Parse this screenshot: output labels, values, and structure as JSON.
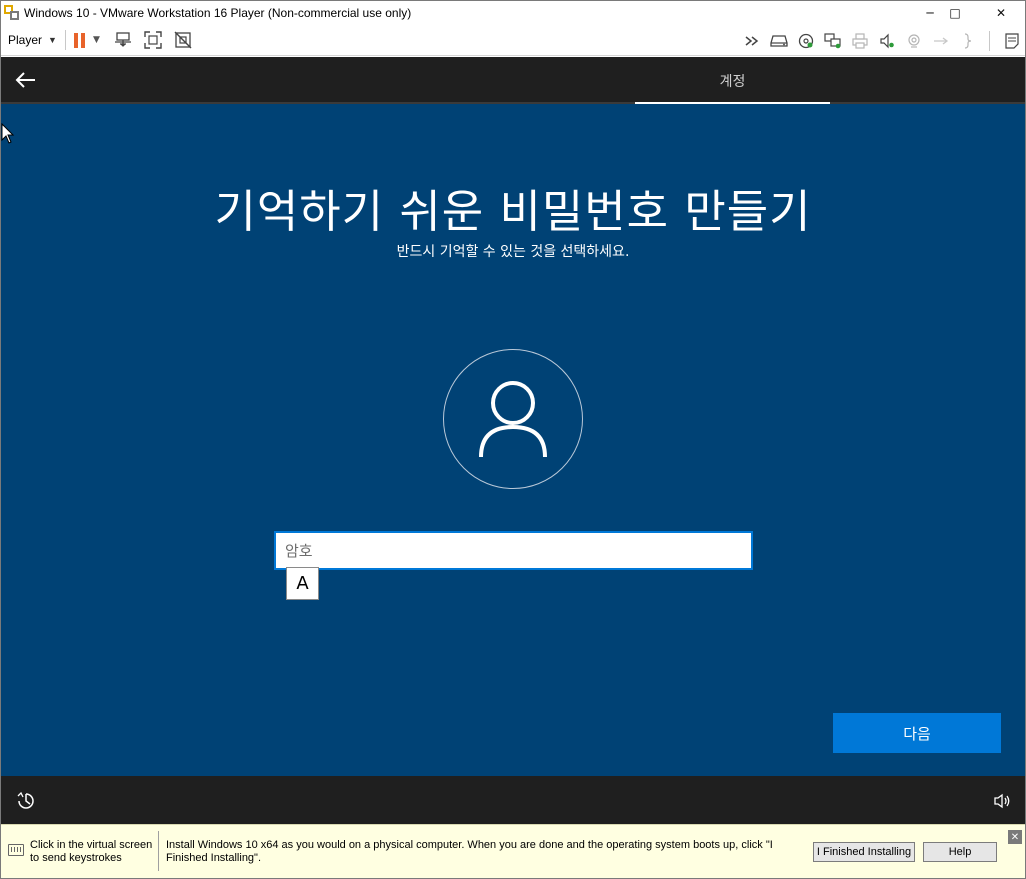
{
  "window": {
    "title": "Windows 10 - VMware Workstation 16 Player (Non-commercial use only)",
    "minimize_glyph": "─",
    "maximize_glyph": "□",
    "close_glyph": "✕"
  },
  "toolbar": {
    "player_label": "Player",
    "caret": "▼"
  },
  "oobe": {
    "tab_label": "계정",
    "title": "기억하기 쉬운 비밀번호 만들기",
    "subtitle": "반드시 기억할 수 있는 것을 선택하세요.",
    "password_placeholder": "암호",
    "ime_mode": "A",
    "next_label": "다음"
  },
  "hint": {
    "click_text": "Click in the virtual screen to send keystrokes",
    "install_text": "Install Windows 10 x64 as you would on a physical computer. When you are done and the operating system boots up, click \"I Finished Installing\".",
    "finished_label": "I Finished Installing",
    "help_label": "Help",
    "close_glyph": "✕"
  },
  "colors": {
    "guest_background": "#004275",
    "accent": "#0078d7",
    "bar_dark": "#1f1f1f",
    "pause_orange": "#e8632a",
    "hint_background": "#ffffe1"
  },
  "icons": {
    "toolbar_left": [
      "pause-icon",
      "send-ctrl-alt-del-icon",
      "fullscreen-icon",
      "unity-icon"
    ],
    "toolbar_right": [
      "fast-forward-icon",
      "hard-disk-icon",
      "cd-dvd-icon",
      "network-adapter-icon",
      "printer-icon",
      "sound-card-icon",
      "camera-icon",
      "usb-icon",
      "floppy-icon",
      "message-log-icon"
    ],
    "oobe": [
      "back-arrow-icon",
      "user-avatar-icon",
      "ease-of-access-icon",
      "volume-icon"
    ]
  }
}
